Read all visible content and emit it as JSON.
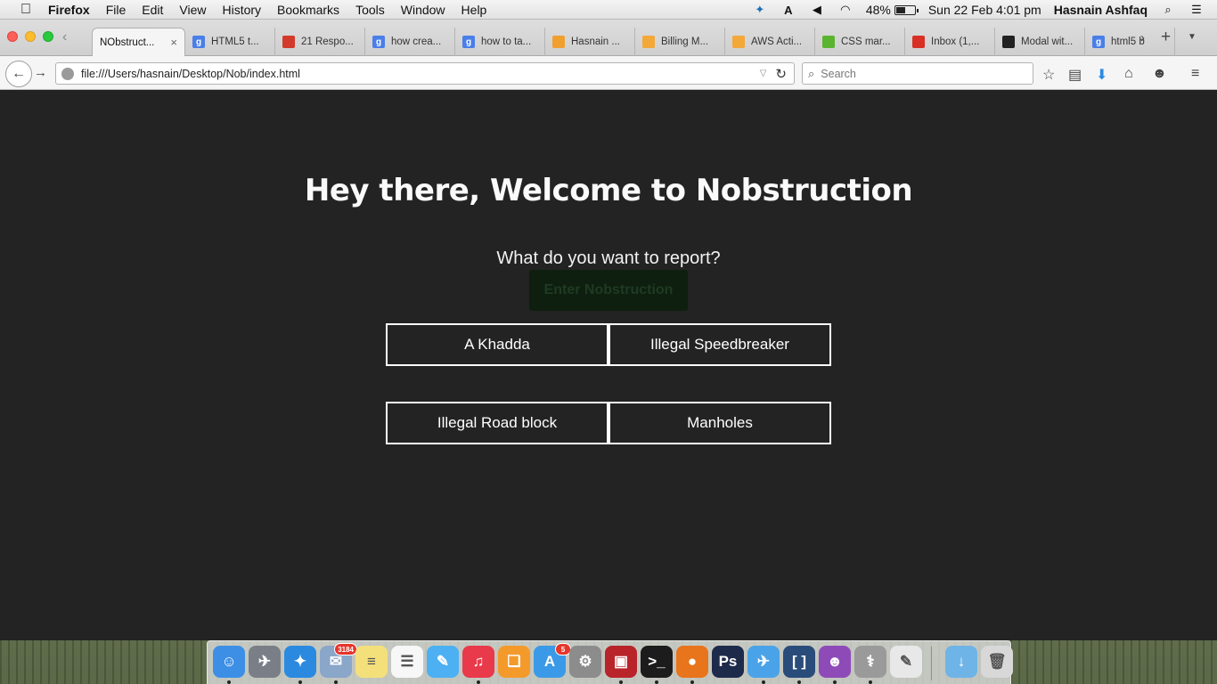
{
  "menubar": {
    "app_name": "Firefox",
    "items": [
      "File",
      "Edit",
      "View",
      "History",
      "Bookmarks",
      "Tools",
      "Window",
      "Help"
    ],
    "battery_percent": "48%",
    "battery_level": 0.48,
    "datetime": "Sun 22 Feb  4:01 pm",
    "user": "Hasnain Ashfaq"
  },
  "browser": {
    "tabs": [
      {
        "title": "NObstruct...",
        "favicon": "page-icon",
        "color": "#ffffff",
        "active": true
      },
      {
        "title": "HTML5 t...",
        "favicon": "google-icon",
        "color": "#4a7ee8"
      },
      {
        "title": "21 Respo...",
        "favicon": "red-logo-icon",
        "color": "#d23b2b"
      },
      {
        "title": "how crea...",
        "favicon": "google-icon",
        "color": "#4a7ee8"
      },
      {
        "title": "how to ta...",
        "favicon": "google-icon",
        "color": "#4a7ee8"
      },
      {
        "title": "Hasnain ...",
        "favicon": "star-logo-icon",
        "color": "#f0a030"
      },
      {
        "title": "Billing M...",
        "favicon": "aws-box-icon",
        "color": "#f3a83a"
      },
      {
        "title": "AWS Acti...",
        "favicon": "aws-box-icon",
        "color": "#f3a83a"
      },
      {
        "title": "CSS mar...",
        "favicon": "w3-icon",
        "color": "#5bb42f"
      },
      {
        "title": "Inbox (1,...",
        "favicon": "gmail-icon",
        "color": "#d93025"
      },
      {
        "title": "Modal wit...",
        "favicon": "github-icon",
        "color": "#222222"
      },
      {
        "title": "html5 b",
        "favicon": "google-icon",
        "color": "#4a7ee8"
      }
    ],
    "url": "file:///Users/hasnain/Desktop/Nob/index.html",
    "search_placeholder": "Search"
  },
  "page": {
    "title": "Hey there, Welcome to Nobstruction",
    "question": "What do you want to report?",
    "enter_button": "Enter Nobstruction",
    "options": [
      "A Khadda",
      "Illegal Speedbreaker",
      "Illegal Road block",
      "Manholes"
    ]
  },
  "dock": {
    "mail_badge": "3184",
    "appstore_badge": "5",
    "apps": [
      {
        "name": "finder-icon",
        "color": "#3d8fe6",
        "glyph": "☺",
        "running": true
      },
      {
        "name": "launchpad-icon",
        "color": "#7a7f87",
        "glyph": "✈",
        "running": false
      },
      {
        "name": "safari-icon",
        "color": "#2b8ae0",
        "glyph": "✦",
        "running": true
      },
      {
        "name": "mail-icon",
        "color": "#8aa6c9",
        "glyph": "✉",
        "running": true
      },
      {
        "name": "notes-icon",
        "color": "#f4e07a",
        "glyph": "≡",
        "running": false
      },
      {
        "name": "reminders-icon",
        "color": "#f7f7f7",
        "glyph": "☰",
        "running": false
      },
      {
        "name": "messages-icon",
        "color": "#4cb0f3",
        "glyph": "✎",
        "running": false
      },
      {
        "name": "itunes-icon",
        "color": "#e83a4a",
        "glyph": "♫",
        "running": true
      },
      {
        "name": "ibooks-icon",
        "color": "#f49a2b",
        "glyph": "❑",
        "running": false
      },
      {
        "name": "appstore-icon",
        "color": "#3a9ae8",
        "glyph": "A",
        "running": false
      },
      {
        "name": "system-preferences-icon",
        "color": "#8c8c8c",
        "glyph": "⚙",
        "running": false
      },
      {
        "name": "photo-booth-icon",
        "color": "#b8242a",
        "glyph": "▣",
        "running": true
      },
      {
        "name": "terminal-icon",
        "color": "#1c1c1c",
        "glyph": ">_",
        "running": true
      },
      {
        "name": "firefox-icon",
        "color": "#e8741c",
        "glyph": "●",
        "running": true
      },
      {
        "name": "photoshop-icon",
        "color": "#1d2a4a",
        "glyph": "Ps",
        "running": false
      },
      {
        "name": "twitter-icon",
        "color": "#4aa3e8",
        "glyph": "✈",
        "running": true
      },
      {
        "name": "brackets-icon",
        "color": "#2a4c7a",
        "glyph": "[ ]",
        "running": true
      },
      {
        "name": "github-icon",
        "color": "#8e4bb8",
        "glyph": "☻",
        "running": true
      },
      {
        "name": "disk-utility-icon",
        "color": "#9a9a9a",
        "glyph": "⚕",
        "running": true
      },
      {
        "name": "textedit-icon",
        "color": "#e8e8e8",
        "glyph": "✎",
        "running": false
      },
      {
        "name": "downloads-folder-icon",
        "color": "#6fb4e6",
        "glyph": "↓",
        "running": false
      },
      {
        "name": "trash-icon",
        "color": "#d8d8d8",
        "glyph": "🗑",
        "running": false
      }
    ]
  }
}
